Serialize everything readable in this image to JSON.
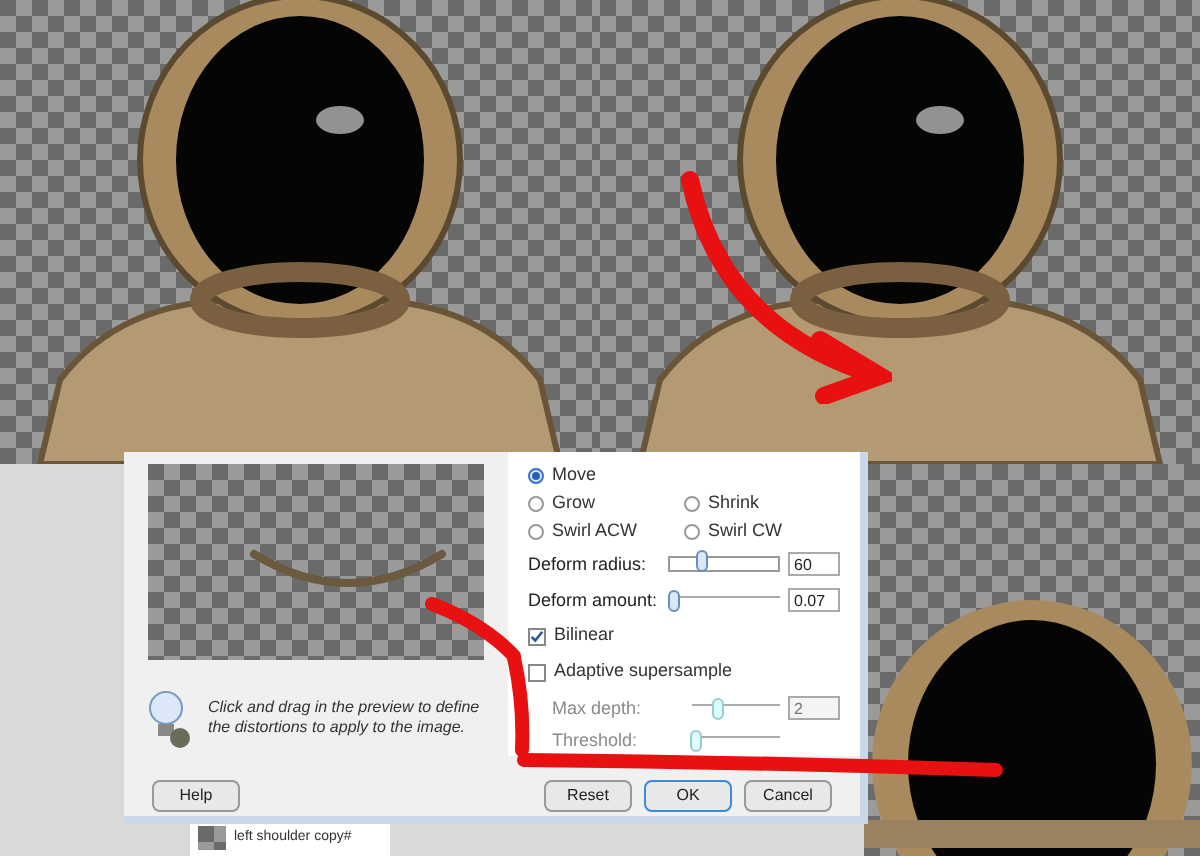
{
  "dialog": {
    "modes": [
      {
        "label": "Move",
        "selected": true
      },
      {
        "label": "Grow",
        "selected": false
      },
      {
        "label": "Shrink",
        "selected": false
      },
      {
        "label": "Swirl ACW",
        "selected": false
      },
      {
        "label": "Swirl CW",
        "selected": false
      }
    ],
    "sliders": [
      {
        "label": "Deform radius:",
        "level": 0.3,
        "value": "60",
        "kind": "track"
      },
      {
        "label": "Deform amount:",
        "level": 0.05,
        "value": "0.07",
        "kind": "line"
      }
    ],
    "options": [
      {
        "label": "Bilinear",
        "checked": true
      },
      {
        "label": "Adaptive supersample",
        "checked": false
      }
    ],
    "sub_sliders": [
      {
        "label": "Max depth:",
        "level": 0.3,
        "value": "2",
        "disabled": true
      },
      {
        "label": "Threshold:",
        "level": 0.05,
        "disabled": true
      }
    ],
    "hint": "Click and drag in the preview to define the distortions to apply to the image.",
    "buttons": [
      {
        "label": "Help",
        "kind": "left"
      },
      {
        "label": "Reset",
        "kind": "right"
      },
      {
        "label": "OK",
        "kind": "default"
      },
      {
        "label": "Cancel",
        "kind": "right"
      }
    ]
  },
  "layer": {
    "name": "left shoulder copy#"
  }
}
